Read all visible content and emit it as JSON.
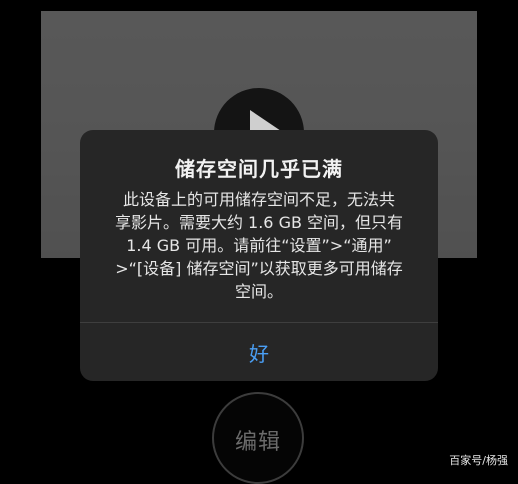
{
  "alert": {
    "title": "储存空间几乎已满",
    "message_lines": [
      "此设备上的可用储存空间不足，无法共",
      "享影片。需要大约 1.6 GB 空间，但只有",
      "1.4 GB 可用。请前往“设置”>“通用”",
      ">“[设备] 储存空间”以获取更多可用储存",
      "空间。"
    ],
    "ok_label": "好"
  },
  "controls": {
    "edit_label": "编辑",
    "play_icon": "play-icon"
  },
  "watermark": "百家号/杨强",
  "colors": {
    "alert_background": "#262626",
    "ok_accent": "#4a9ff5",
    "page_background": "#000000"
  }
}
